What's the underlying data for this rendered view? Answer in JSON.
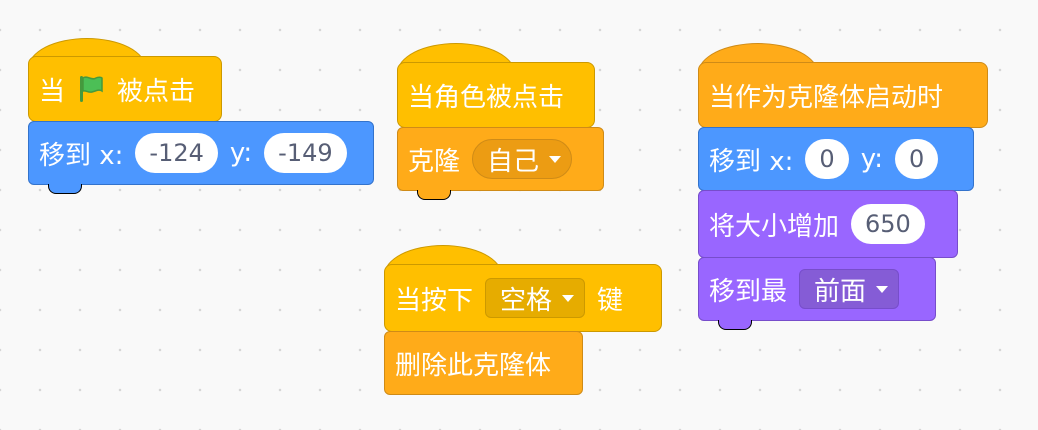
{
  "workspace": {
    "green_flag_stack": {
      "hat_prefix": "当",
      "hat_suffix": "被点击",
      "move_label": "移到 x:",
      "x_value": "-124",
      "y_label": "y:",
      "y_value": "-149"
    },
    "sprite_click_stack": {
      "hat_label": "当角色被点击",
      "clone_label": "克隆",
      "clone_target": "自己"
    },
    "key_press_stack": {
      "hat_prefix": "当按下",
      "key_option": "空格",
      "hat_suffix": "键",
      "delete_clone_label": "删除此克隆体"
    },
    "clone_start_stack": {
      "hat_label": "当作为克隆体启动时",
      "move_label": "移到 x:",
      "x_value": "0",
      "y_label": "y:",
      "y_value": "0",
      "size_label": "将大小增加",
      "size_value": "650",
      "layer_label": "移到最",
      "layer_option": "前面"
    }
  },
  "colors": {
    "events": "#FFBF00",
    "control": "#FFAB19",
    "motion": "#4C97FF",
    "looks": "#9966FF",
    "flag": "#4CBF56"
  },
  "icons": {
    "flag": "green-flag-icon",
    "dropdown_caret": "caret-down-icon"
  }
}
